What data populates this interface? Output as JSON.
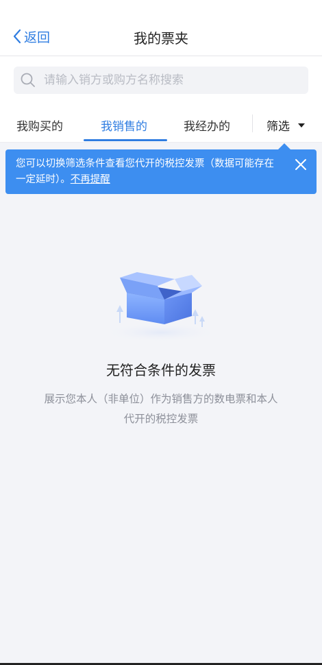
{
  "header": {
    "back_label": "返回",
    "title": "我的票夹"
  },
  "search": {
    "placeholder": "请输入销方或购方名称搜索",
    "icon": "search-icon"
  },
  "tabs": [
    {
      "label": "我购买的",
      "active": false
    },
    {
      "label": "我销售的",
      "active": true
    },
    {
      "label": "我经办的",
      "active": false
    }
  ],
  "filter": {
    "label": "筛选",
    "icon": "caret-down-icon"
  },
  "notice": {
    "text": "您可以切换筛选条件查看您代开的税控发票（数据可能存在一定延时）。",
    "link": "不再提醒",
    "close_icon": "close-icon",
    "color": "#3d8ef0"
  },
  "empty": {
    "icon": "empty-box-illustration",
    "title": "无符合条件的发票",
    "description": "展示您本人（非单位）作为销售方的数电票和本人代开的税控发票"
  },
  "colors": {
    "accent": "#2f7de1",
    "background": "#f3f4f8"
  }
}
